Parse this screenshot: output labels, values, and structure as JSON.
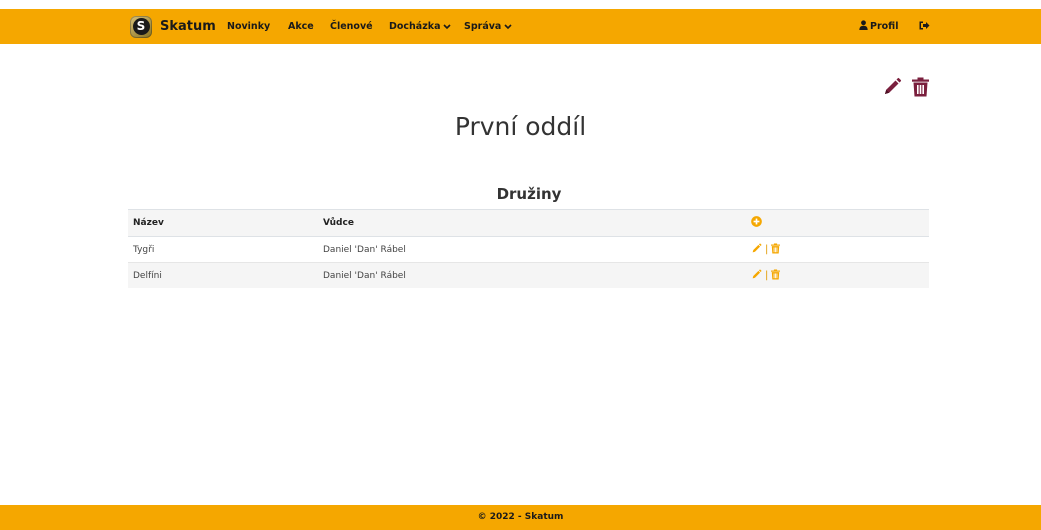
{
  "navbar": {
    "brand_letter": "S",
    "brand": "Skatum",
    "items": [
      {
        "label": "Novinky"
      },
      {
        "label": "Akce"
      },
      {
        "label": "Členové"
      },
      {
        "label": "Docházka"
      },
      {
        "label": "Správa"
      }
    ],
    "profile": "Profil"
  },
  "page": {
    "title": "První oddíl",
    "section_title": "Družiny"
  },
  "table": {
    "headers": {
      "name": "Název",
      "leader": "Vůdce"
    },
    "rows": [
      {
        "name": "Tygři",
        "leader": "Daniel 'Dan' Rábel"
      },
      {
        "name": "Delfíni",
        "leader": "Daniel 'Dan' Rábel"
      }
    ],
    "separator": "|"
  },
  "footer": {
    "text": "© 2022 - Skatum"
  },
  "colors": {
    "brand": "#f5a700",
    "action_dark": "#7a1f3d",
    "action_light": "#f5a700"
  },
  "icons": [
    "pencil-icon",
    "trash-icon",
    "plus-circle-icon",
    "user-icon",
    "sign-out-icon",
    "chevron-down-icon"
  ]
}
